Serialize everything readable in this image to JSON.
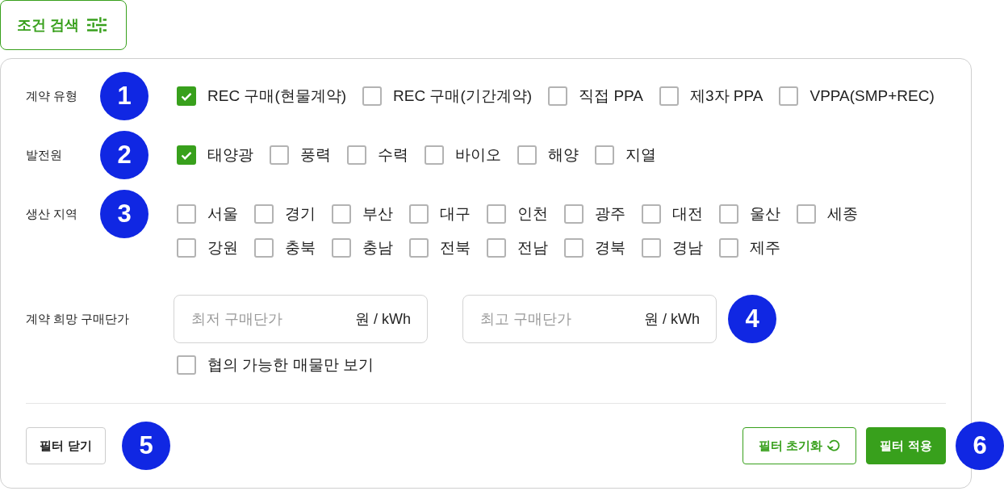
{
  "search_toggle": {
    "label": "조건 검색"
  },
  "filters": [
    {
      "label": "계약 유형",
      "step": "1",
      "options": [
        {
          "label": "REC 구매(현물계약)",
          "checked": true
        },
        {
          "label": "REC 구매(기간계약)",
          "checked": false
        },
        {
          "label": "직접 PPA",
          "checked": false
        },
        {
          "label": "제3자 PPA",
          "checked": false
        },
        {
          "label": "VPPA(SMP+REC)",
          "checked": false
        }
      ]
    },
    {
      "label": "발전원",
      "step": "2",
      "options": [
        {
          "label": "태양광",
          "checked": true
        },
        {
          "label": "풍력",
          "checked": false
        },
        {
          "label": "수력",
          "checked": false
        },
        {
          "label": "바이오",
          "checked": false
        },
        {
          "label": "해양",
          "checked": false
        },
        {
          "label": "지열",
          "checked": false
        }
      ]
    },
    {
      "label": "생산 지역",
      "step": "3",
      "options": [
        {
          "label": "서울",
          "checked": false
        },
        {
          "label": "경기",
          "checked": false
        },
        {
          "label": "부산",
          "checked": false
        },
        {
          "label": "대구",
          "checked": false
        },
        {
          "label": "인천",
          "checked": false
        },
        {
          "label": "광주",
          "checked": false
        },
        {
          "label": "대전",
          "checked": false
        },
        {
          "label": "울산",
          "checked": false
        },
        {
          "label": "세종",
          "checked": false
        },
        {
          "label": "강원",
          "checked": false
        },
        {
          "label": "충북",
          "checked": false
        },
        {
          "label": "충남",
          "checked": false
        },
        {
          "label": "전북",
          "checked": false
        },
        {
          "label": "전남",
          "checked": false
        },
        {
          "label": "경북",
          "checked": false
        },
        {
          "label": "경남",
          "checked": false
        },
        {
          "label": "제주",
          "checked": false
        }
      ]
    }
  ],
  "price_range": {
    "label": "계약 희망 구매단가",
    "fields": [
      {
        "placeholder": "최저 구매단가",
        "unit": "원 / kWh"
      },
      {
        "placeholder": "최고 구매단가",
        "unit": "원 / kWh"
      }
    ],
    "step": "4",
    "negotiable": {
      "label": "협의 가능한 매물만 보기",
      "checked": false
    }
  },
  "footer": {
    "close": {
      "label": "필터 닫기",
      "step": "5"
    },
    "reset": {
      "label": "필터 초기화"
    },
    "apply": {
      "label": "필터 적용",
      "step": "6"
    }
  }
}
